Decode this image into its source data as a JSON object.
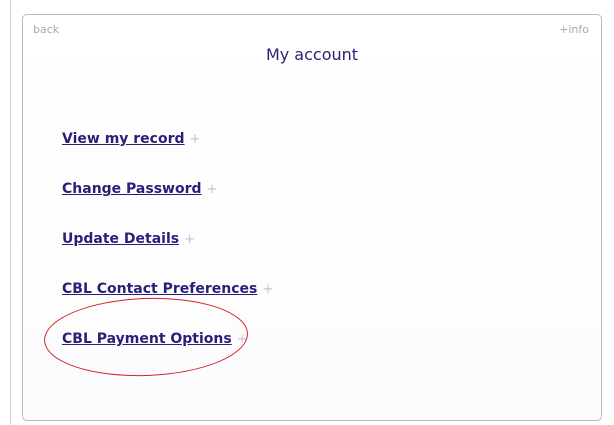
{
  "panel": {
    "back_label": "back",
    "info_label": "+info",
    "title": "My account"
  },
  "menu": {
    "items": [
      {
        "label": "View my record",
        "expand": "+"
      },
      {
        "label": "Change Password",
        "expand": "+"
      },
      {
        "label": "Update Details",
        "expand": "+"
      },
      {
        "label": "CBL Contact Preferences",
        "expand": "+"
      },
      {
        "label": "CBL Payment Options",
        "expand": "+"
      }
    ]
  },
  "annotation": {
    "highlighted_item": "CBL Payment Options",
    "color": "#d42424"
  },
  "colors": {
    "link": "#2a1f78",
    "muted": "#a7a7b4",
    "border": "#b9b9c3"
  }
}
